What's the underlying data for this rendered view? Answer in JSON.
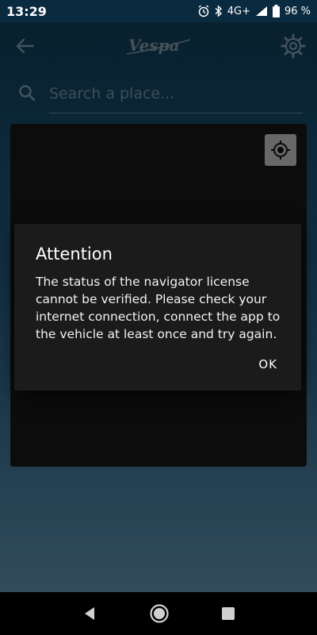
{
  "status_bar": {
    "time": "13:29",
    "network": "4G+",
    "battery": "96 %",
    "icons": [
      "alarm-icon",
      "bluetooth-icon",
      "signal-icon",
      "battery-icon"
    ]
  },
  "toolbar": {
    "back_icon": "arrow-left-icon",
    "logo_text": "Vespa",
    "settings_icon": "gear-icon"
  },
  "search": {
    "placeholder": "Search a place..."
  },
  "map": {
    "locate_icon": "gps-target-icon"
  },
  "dialog": {
    "title": "Attention",
    "message": "The status of the navigator license cannot be verified. Please check your internet connection, connect the app to the vehicle at least once and try again.",
    "ok_label": "OK"
  },
  "nav_bar": {
    "icons": [
      "back-triangle-icon",
      "home-circle-icon",
      "recents-square-icon"
    ]
  },
  "colors": {
    "background_top": "#0f3952",
    "background_bottom": "#5a89a6",
    "dialog_bg": "#1b1b1b",
    "map_bg": "#171717"
  }
}
